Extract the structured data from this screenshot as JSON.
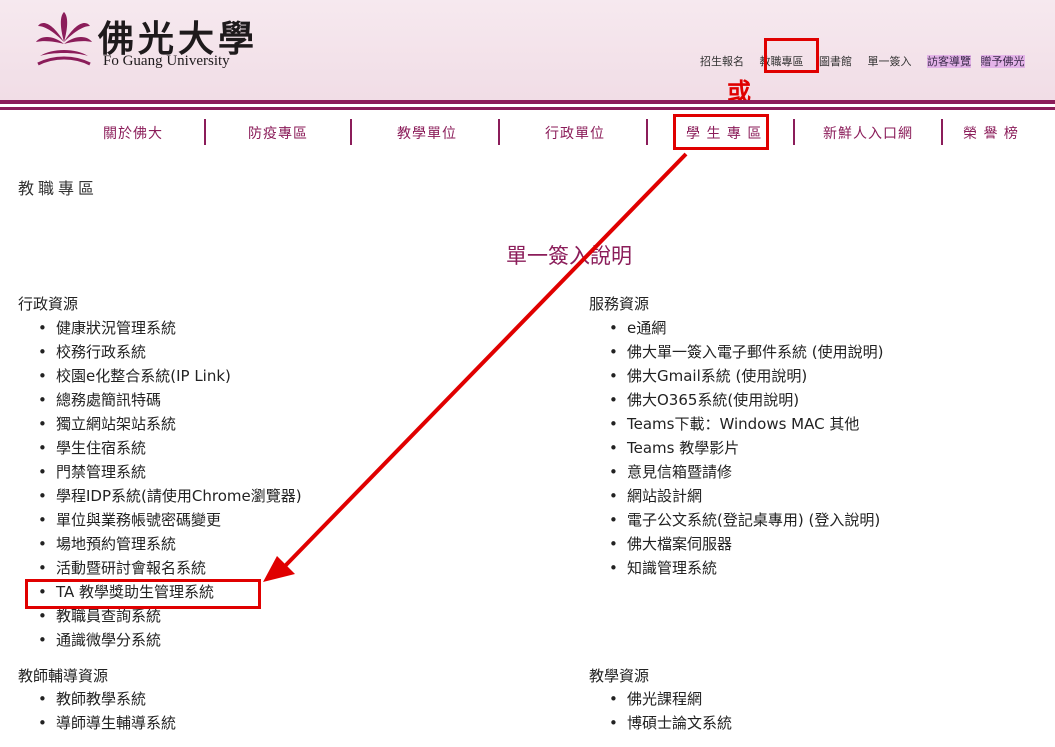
{
  "header": {
    "logo_cn": "佛光大學",
    "logo_en": "Fo Guang University",
    "top_links": [
      {
        "label": "招生報名",
        "highlight": false
      },
      {
        "label": "教職專區",
        "highlight": false
      },
      {
        "label": "圖書館",
        "highlight": false
      },
      {
        "label": "單一簽入",
        "highlight": false
      },
      {
        "label": "訪客導覽",
        "highlight": true
      },
      {
        "label": "贈予佛光",
        "highlight": true
      }
    ],
    "or_note": "或"
  },
  "nav": {
    "items": [
      "關於佛大",
      "防疫專區",
      "教學單位",
      "行政單位",
      "學 生 專 區",
      "新鮮人入口網",
      "榮 譽 榜"
    ]
  },
  "page": {
    "section_title": "教職專區",
    "center_title": "單一簽入說明"
  },
  "admin": {
    "heading": "行政資源",
    "items": [
      "健康狀況管理系統",
      "校務行政系統",
      "校園e化整合系統(IP Link)",
      "總務處簡訊特碼",
      "獨立網站架站系統",
      "學生住宿系統",
      "門禁管理系統",
      "學程IDP系統(請使用Chrome瀏覽器)",
      "單位與業務帳號密碼變更",
      "場地預約管理系統",
      "活動暨研討會報名系統",
      "TA 教學獎助生管理系統",
      "教職員查詢系統",
      "通識微學分系統"
    ]
  },
  "service": {
    "heading": "服務資源",
    "items": [
      "e通網",
      "佛大單一簽入電子郵件系統 (使用說明)",
      "佛大Gmail系統 (使用說明)",
      "佛大O365系統(使用說明)",
      "Teams下載：Windows  MAC 其他",
      "Teams 教學影片",
      "意見信箱暨請修",
      "網站設計網",
      "電子公文系統(登記桌專用) (登入說明)",
      "佛大檔案伺服器",
      "知識管理系統"
    ]
  },
  "tutor": {
    "heading": "教師輔導資源",
    "items": [
      "教師教學系統",
      "導師導生輔導系統"
    ]
  },
  "teaching": {
    "heading": "教學資源",
    "items": [
      "佛光課程網",
      "博碩士論文系統"
    ]
  },
  "colors": {
    "brand": "#8b1d5a",
    "header_bg": "#f3e2ea",
    "annotation": "#e00000",
    "highlight_bg": "#e3b3e8"
  }
}
